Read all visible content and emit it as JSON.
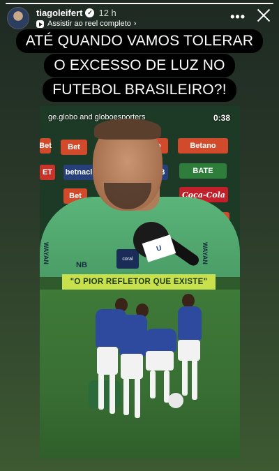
{
  "story": {
    "progress_fraction": 1.0,
    "username": "tiagoleifert",
    "verified": true,
    "time_ago": "12 h",
    "reel_link_label": "Assistir ao reel completo",
    "more_label": "•••"
  },
  "headline": {
    "lines": [
      "ATÉ QUANDO VAMOS TOLERAR",
      "O EXCESSO DE LUZ NO",
      "FUTEBOL BRASILEIRO?!"
    ]
  },
  "video": {
    "watermark": "ge.globo and globoesporters",
    "timer": "0:38",
    "caption": "\"O PIOR REFLETOR QUE EXISTE\"",
    "boards": [
      "Bet",
      "Betano",
      "Betano",
      "BATE",
      "ge",
      "betnacl",
      "OOB",
      "Coca-Cola",
      "Bet",
      "ET",
      "no",
      "no"
    ],
    "mic_label": "U",
    "patch_label": "coral",
    "brand_mark": "NB",
    "side_text_left": "WAYAN",
    "side_text_right": "WAYAN"
  },
  "colors": {
    "caption_bg": "#c7e04c",
    "jersey_gk": "#5bb57a",
    "team_shirt": "#2d4a9e",
    "headline_bg": "#000000"
  }
}
